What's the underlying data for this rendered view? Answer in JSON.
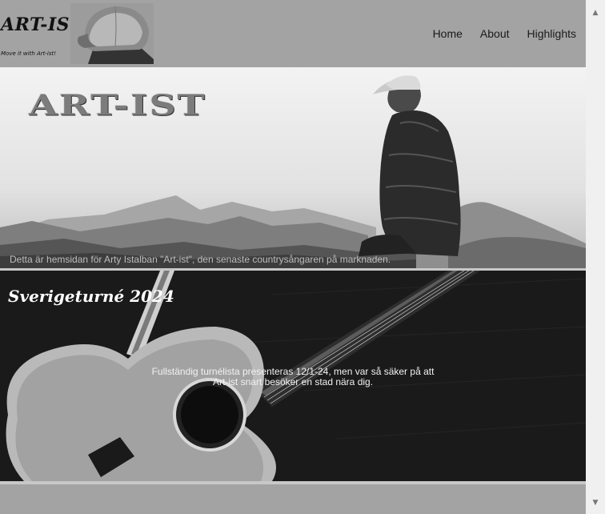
{
  "header": {
    "logo": "ART-IST",
    "tagline": "Move it with Art-ist!",
    "nav": [
      "Home",
      "About",
      "Highlights"
    ]
  },
  "hero": {
    "title": "ART-IST",
    "caption": "Detta är hemsidan för Arty Istalban \"Art-ist\", den senaste countrysångaren på marknaden."
  },
  "tour": {
    "title": "Sverigeturné 2024",
    "text": "Fullständig turnélista presenteras 12/1-24, men var så säker på att Art-ist snart besöker en stad nära dig."
  },
  "scrollbar": {
    "up_icon": "chevron-up-icon",
    "down_icon": "chevron-down-icon"
  }
}
